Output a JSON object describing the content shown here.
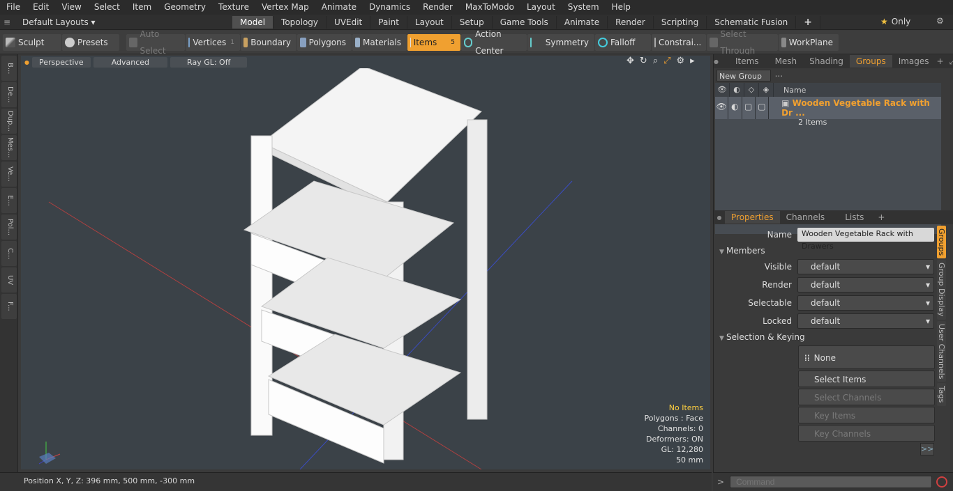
{
  "menu": [
    "File",
    "Edit",
    "View",
    "Select",
    "Item",
    "Geometry",
    "Texture",
    "Vertex Map",
    "Animate",
    "Dynamics",
    "Render",
    "MaxToModo",
    "Layout",
    "System",
    "Help"
  ],
  "layout_selector": "Default Layouts",
  "layout_tabs": [
    "Model",
    "Topology",
    "UVEdit",
    "Paint",
    "Layout",
    "Setup",
    "Game Tools",
    "Animate",
    "Render",
    "Scripting",
    "Schematic Fusion"
  ],
  "layout_active": "Model",
  "only_label": "Only",
  "toolbar": {
    "sculpt": "Sculpt",
    "presets": "Presets",
    "auto_select": "Auto Select",
    "vertices": "Vertices",
    "vertices_badge": "1",
    "boundary": "Boundary",
    "polygons": "Polygons",
    "materials": "Materials",
    "items": "Items",
    "items_badge": "5",
    "action_center": "Action Center",
    "symmetry": "Symmetry",
    "falloff": "Falloff",
    "constraints": "Constrai...",
    "select_through": "Select Through",
    "workplane": "WorkPlane"
  },
  "left_tabs": [
    "B...",
    "De...",
    "Dup...",
    "Mes...",
    "Ve...",
    "E...",
    "Pol...",
    "C...",
    "UV",
    "F..."
  ],
  "viewport": {
    "perspective": "Perspective",
    "advanced": "Advanced",
    "raygl": "Ray GL: Off",
    "info": {
      "selection": "No Items",
      "polygons": "Polygons : Face",
      "channels": "Channels: 0",
      "deformers": "Deformers: ON",
      "gl": "GL: 12,280",
      "scale": "50 mm"
    }
  },
  "status": {
    "position": "Position X, Y, Z:  396 mm, 500 mm, -300 mm"
  },
  "top_panel_tabs": [
    "Items",
    "Mesh ...",
    "Shading",
    "Groups",
    "Images"
  ],
  "top_panel_active": "Groups",
  "new_group_btn": "New Group",
  "groups_list": {
    "name_header": "Name",
    "rows": [
      {
        "name": "Wooden Vegetable Rack with Dr ...",
        "sub": "2 Items"
      }
    ]
  },
  "props_tabs": [
    "Properties",
    "Channels",
    "Lists"
  ],
  "props_active": "Properties",
  "properties": {
    "name_label": "Name",
    "name_value": "Wooden Vegetable Rack with Drawers",
    "members_section": "Members",
    "fields": [
      {
        "label": "Visible",
        "value": "default"
      },
      {
        "label": "Render",
        "value": "default"
      },
      {
        "label": "Selectable",
        "value": "default"
      },
      {
        "label": "Locked",
        "value": "default"
      }
    ],
    "keying_section": "Selection & Keying",
    "none_btn": "None",
    "select_items": "Select Items",
    "select_channels": "Select Channels",
    "key_items": "Key Items",
    "key_channels": "Key Channels",
    "more": ">>"
  },
  "right_vtabs": [
    "Groups",
    "Group Display",
    "User Channels",
    "Tags"
  ],
  "right_vtab_active": "Groups",
  "command_placeholder": "Command"
}
